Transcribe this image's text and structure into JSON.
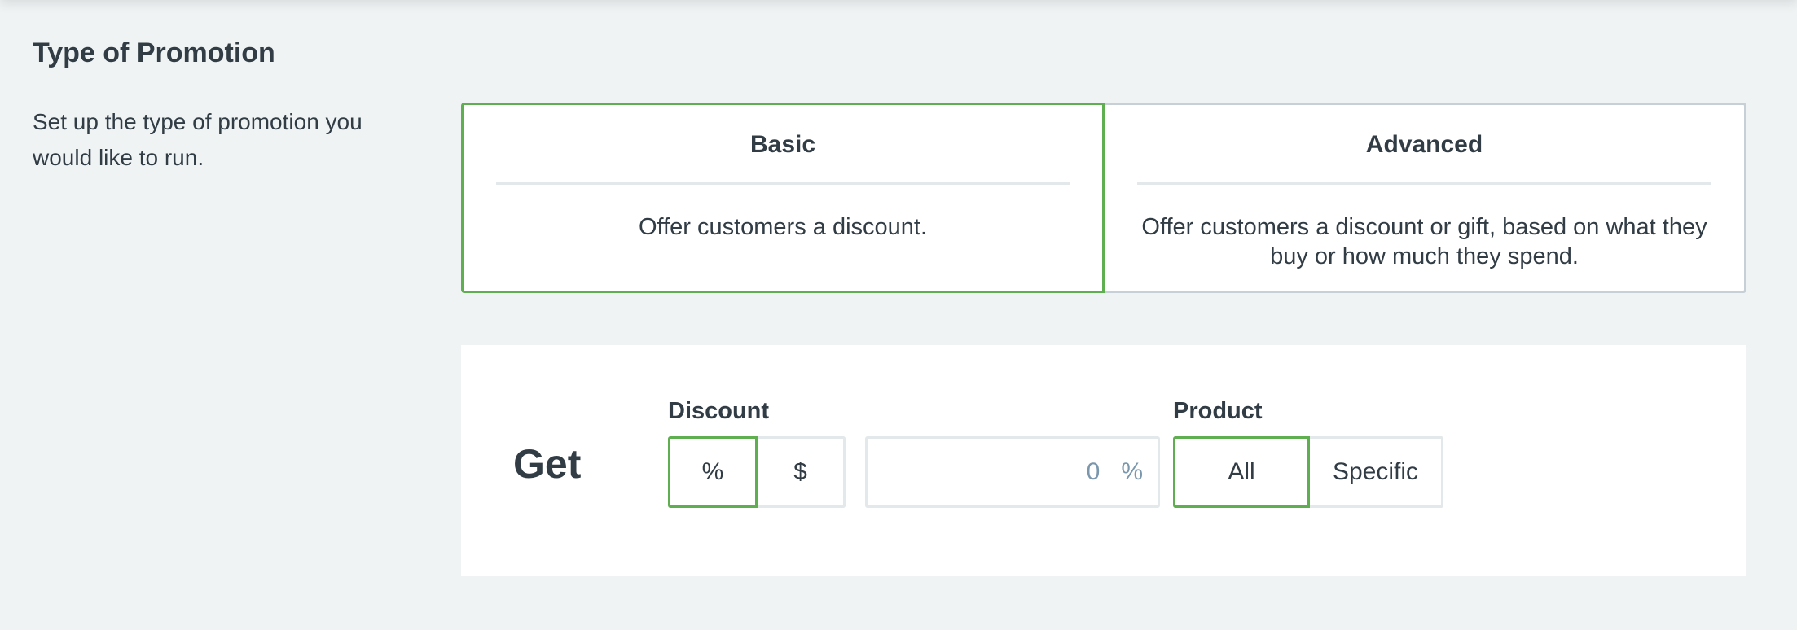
{
  "section": {
    "title": "Type of Promotion",
    "description": "Set up the type of promotion you would like to run."
  },
  "promotion_types": [
    {
      "title": "Basic",
      "description": "Offer customers a discount.",
      "selected": true
    },
    {
      "title": "Advanced",
      "description": "Offer customers a discount or gift, based on what they buy or how much they spend.",
      "selected": false
    }
  ],
  "get_panel": {
    "label": "Get",
    "discount": {
      "label": "Discount",
      "options": [
        "%",
        "$"
      ],
      "selected": "%"
    },
    "amount": {
      "value": "0",
      "unit": "%"
    },
    "product": {
      "label": "Product",
      "options": [
        "All",
        "Specific"
      ],
      "selected": "All"
    }
  },
  "colors": {
    "accent": "#5fae50",
    "background": "#eff3f4",
    "text": "#313c45",
    "muted_text": "#7a97ad",
    "border": "#e3e8ea",
    "card_border": "#c6d0d6"
  }
}
